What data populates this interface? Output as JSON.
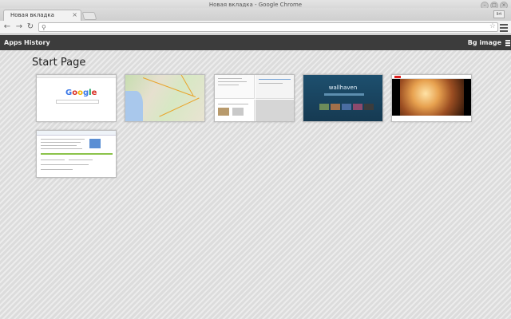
{
  "window": {
    "title": "Новая вкладка - Google Chrome",
    "minimize": "–",
    "maximize": "□",
    "close": "×"
  },
  "tabs": [
    {
      "label": "Новая вкладка",
      "close": "×"
    }
  ],
  "user_badge": "lirt",
  "toolbar": {
    "back": "←",
    "forward": "→",
    "reload": "↻",
    "search_glyph": "🔍",
    "address_value": "",
    "star": "☆"
  },
  "bookmarks": {
    "apps": "Apps",
    "history": "History",
    "bg_image": "Bg image"
  },
  "page": {
    "title": "Start Page",
    "tiles": [
      {
        "name": "google"
      },
      {
        "name": "maps"
      },
      {
        "name": "pages"
      },
      {
        "name": "wallhaven",
        "caption": "wallhaven"
      },
      {
        "name": "video"
      },
      {
        "name": "document"
      }
    ],
    "google_logo": [
      "G",
      "o",
      "o",
      "g",
      "l",
      "e"
    ]
  },
  "colors": {
    "bookmark_bar": "#3c3c3c",
    "content_bg": "#dcdcdc",
    "google_blue": "#3b78e7",
    "google_red": "#d93025",
    "google_yellow": "#f4b400",
    "google_green": "#0f9d58"
  }
}
